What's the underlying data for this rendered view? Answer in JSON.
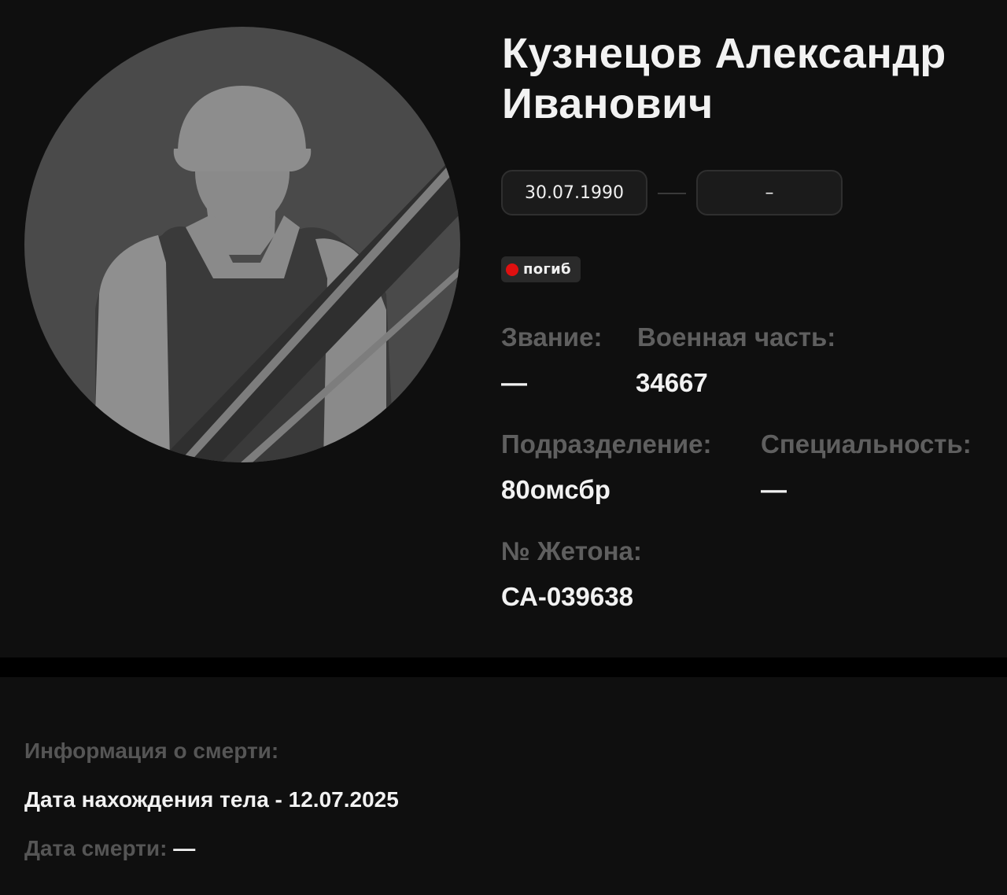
{
  "person": {
    "last_name_first_name": "Кузнецов Александр",
    "patronymic": "Иванович"
  },
  "dates": {
    "birth": "30.07.1990",
    "death": "–"
  },
  "status": {
    "label": "погиб",
    "color": "#e01010"
  },
  "fields": {
    "rank_label": "Звание:",
    "rank_value": "—",
    "unit_label": "Военная часть:",
    "unit_value": "34667",
    "division_label": "Подразделение:",
    "division_value": "80омсбр",
    "specialty_label": "Специальность:",
    "specialty_value": "—",
    "token_label": "№ Жетона:",
    "token_value": "СА-039638"
  },
  "death_info": {
    "heading": "Информация о смерти:",
    "body_found_line": "Дата нахождения тела - 12.07.2025",
    "death_date_label": "Дата смерти:",
    "death_date_value": "—"
  },
  "avatar": {
    "icon": "soldier-silhouette-with-mourning-ribbon-icon"
  }
}
